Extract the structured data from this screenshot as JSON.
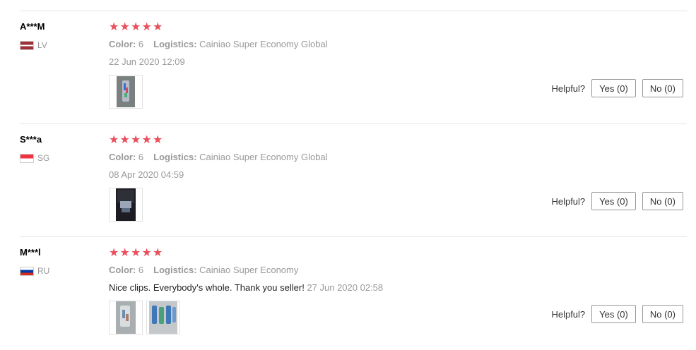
{
  "helpful_label": "Helpful?",
  "star_glyph": "★",
  "labels": {
    "color": "Color:",
    "logistics": "Logistics:"
  },
  "reviews": [
    {
      "user": "A***M",
      "country": "LV",
      "flag_colors": [
        "#9e3039",
        "#ffffff",
        "#9e3039"
      ],
      "rating": 5,
      "color_value": "6",
      "logistics_value": "Cainiao Super Economy Global",
      "text": "",
      "date": "22 Jun 2020 12:09",
      "photos": 1,
      "yes_label": "Yes (0)",
      "no_label": "No (0)"
    },
    {
      "user": "S***a",
      "country": "SG",
      "flag_colors": [
        "#ef3340",
        "#ffffff"
      ],
      "rating": 5,
      "color_value": "6",
      "logistics_value": "Cainiao Super Economy Global",
      "text": "",
      "date": "08 Apr 2020 04:59",
      "photos": 1,
      "yes_label": "Yes (0)",
      "no_label": "No (0)"
    },
    {
      "user": "M***l",
      "country": "RU",
      "flag_colors": [
        "#ffffff",
        "#0039a6",
        "#d52b1e"
      ],
      "rating": 5,
      "color_value": "6",
      "logistics_value": "Cainiao Super Economy",
      "text": "Nice clips. Everybody's whole. Thank you seller!",
      "date": "27 Jun 2020 02:58",
      "photos": 2,
      "yes_label": "Yes (0)",
      "no_label": "No (0)"
    }
  ]
}
